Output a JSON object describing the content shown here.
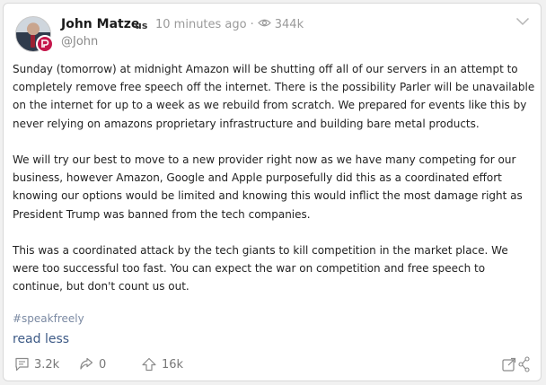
{
  "post": {
    "author_name": "John Matze",
    "country": "us",
    "time": "10 minutes ago",
    "separator": "·",
    "views": "344k",
    "handle": "@John",
    "paragraphs": [
      "Sunday (tomorrow) at midnight Amazon will be shutting off all of our servers in an attempt to completely remove free speech off the internet. There is the possibility Parler will be unavailable on the internet for up to a week as we rebuild from scratch. We prepared for events like this by never relying on amazons proprietary infrastructure and building bare metal products.",
      "We will try our best to move to a new provider right now as we have many competing for our business, however Amazon, Google and Apple purposefully did this as a coordinated effort knowing our options would be limited and knowing this would inflict the most damage right as President Trump was banned from the tech companies.",
      "This was a coordinated attack by the tech giants to kill competition in the market place. We were too successful too fast. You can expect the war on competition and free speech to continue, but don't count us out."
    ],
    "hashtag": "#speakfreely",
    "read_less": "read less",
    "actions": {
      "comments": "3.2k",
      "echoes": "0",
      "upvotes": "16k"
    }
  },
  "icons": {
    "eye": "eye-icon",
    "chevron": "chevron-down-icon",
    "comment": "comment-icon",
    "echo": "echo-icon",
    "upvote": "upvote-icon",
    "share": "share-icon"
  },
  "colors": {
    "badge": "#c5164b",
    "link": "#3d5a86",
    "hashtag": "#7b8aa3",
    "muted": "#9a9a9a"
  }
}
